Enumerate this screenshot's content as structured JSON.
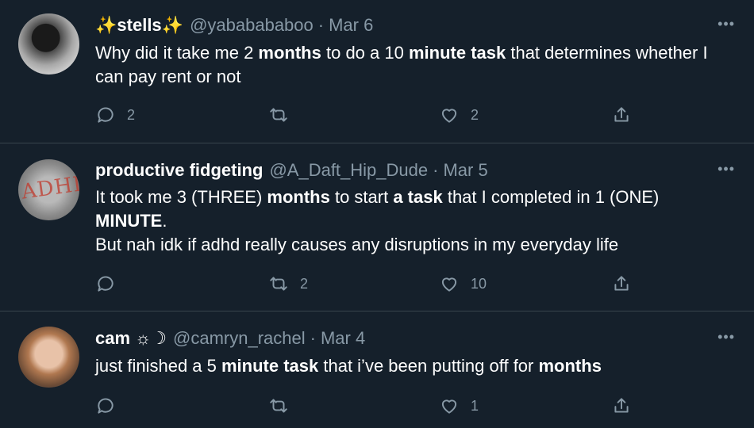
{
  "tweets": [
    {
      "name": "stells",
      "name_prefix": "✨",
      "name_suffix": "✨",
      "handle": "@yababababoo",
      "date": "Mar 6",
      "body_segments": [
        {
          "text": "Why did it take me 2 ",
          "bold": false
        },
        {
          "text": "months",
          "bold": true
        },
        {
          "text": " to do a 10 ",
          "bold": false
        },
        {
          "text": "minute task",
          "bold": true
        },
        {
          "text": " that determines whether I can pay rent or not",
          "bold": false
        }
      ],
      "reply_count": "2",
      "retweet_count": "",
      "like_count": "2"
    },
    {
      "name": "productive fidgeting",
      "handle": "@A_Daft_Hip_Dude",
      "date": "Mar 5",
      "avatar_text": "ADHD",
      "body_segments": [
        {
          "text": "It took me 3 (THREE) ",
          "bold": false
        },
        {
          "text": "months",
          "bold": true
        },
        {
          "text": " to start ",
          "bold": false
        },
        {
          "text": "a task",
          "bold": true
        },
        {
          "text": " that I completed in 1 (ONE) ",
          "bold": false
        },
        {
          "text": "MINUTE",
          "bold": true
        },
        {
          "text": ".",
          "bold": false
        },
        {
          "text": "\n",
          "bold": false
        },
        {
          "text": "But nah idk if adhd really causes any disruptions in my everyday life",
          "bold": false
        }
      ],
      "reply_count": "",
      "retweet_count": "2",
      "like_count": "10"
    },
    {
      "name": "cam ☼☽",
      "handle": "@camryn_rachel",
      "date": "Mar 4",
      "body_segments": [
        {
          "text": "just finished a 5 ",
          "bold": false
        },
        {
          "text": "minute task",
          "bold": true
        },
        {
          "text": " that i’ve been putting off for ",
          "bold": false
        },
        {
          "text": "months",
          "bold": true
        }
      ],
      "reply_count": "",
      "retweet_count": "",
      "like_count": "1"
    }
  ],
  "more_icon_glyph": "•••",
  "icons": [
    "reply-icon",
    "retweet-icon",
    "like-icon",
    "share-icon",
    "more-icon"
  ],
  "colors": {
    "background": "#15202b",
    "secondary_text": "#8899a6",
    "divider": "#38444d",
    "primary_text": "#ffffff"
  }
}
